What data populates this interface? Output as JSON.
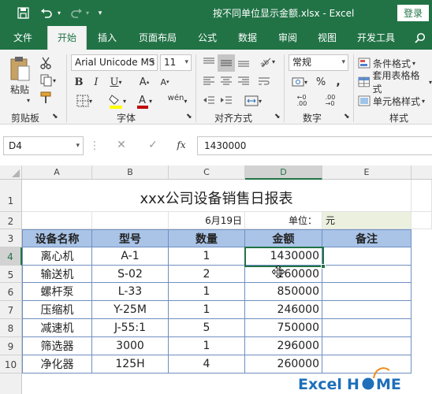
{
  "titlebar": {
    "document_title": "按不同单位显示金额.xlsx  -  Excel",
    "login_label": "登录",
    "icons": [
      "save-icon",
      "undo-icon",
      "redo-icon",
      "customize-qat-icon"
    ]
  },
  "tabs": [
    {
      "label": "文件",
      "active": false
    },
    {
      "label": "开始",
      "active": true
    },
    {
      "label": "插入",
      "active": false
    },
    {
      "label": "页面布局",
      "active": false
    },
    {
      "label": "公式",
      "active": false
    },
    {
      "label": "数据",
      "active": false
    },
    {
      "label": "审阅",
      "active": false
    },
    {
      "label": "视图",
      "active": false
    },
    {
      "label": "开发工具",
      "active": false
    }
  ],
  "ribbon": {
    "clipboard": {
      "label": "剪贴板",
      "paste_label": "粘贴"
    },
    "font": {
      "label": "字体",
      "font_name": "Arial Unicode MS",
      "font_size": "11",
      "font_color": "#c00000",
      "fill_color": "#ffff00"
    },
    "alignment": {
      "label": "对齐方式"
    },
    "number": {
      "label": "数字",
      "format": "常规"
    },
    "styles": {
      "label": "样式",
      "conditional_format": "条件格式",
      "format_as_table": "套用表格格式",
      "cell_styles": "单元格样式"
    }
  },
  "formula_bar": {
    "name_box": "D4",
    "value": "1430000"
  },
  "sheet": {
    "columns": [
      "A",
      "B",
      "C",
      "D",
      "E"
    ],
    "rows": [
      "1",
      "2",
      "3",
      "4",
      "5",
      "6",
      "7",
      "8",
      "9",
      "10"
    ],
    "title": "xxx公司设备销售日报表",
    "date": "6月19日",
    "unit_label": "单位：",
    "unit_value": "元",
    "headers": [
      "设备名称",
      "型号",
      "数量",
      "金额",
      "备注"
    ],
    "data": [
      [
        "离心机",
        "A-1",
        "1",
        "1430000",
        ""
      ],
      [
        "输送机",
        "S-02",
        "2",
        "160000",
        ""
      ],
      [
        "螺杆泵",
        "L-33",
        "1",
        "850000",
        ""
      ],
      [
        "压缩机",
        "Y-25M",
        "1",
        "246000",
        ""
      ],
      [
        "减速机",
        "J-55:1",
        "5",
        "750000",
        ""
      ],
      [
        "筛选器",
        "3000",
        "1",
        "296000",
        ""
      ],
      [
        "净化器",
        "125H",
        "4",
        "260000",
        ""
      ]
    ]
  },
  "colors": {
    "excel_green": "#217346",
    "header_fill": "#a9c4e7",
    "unit_fill": "#ebf1de"
  },
  "watermark": "ExcelHOME"
}
